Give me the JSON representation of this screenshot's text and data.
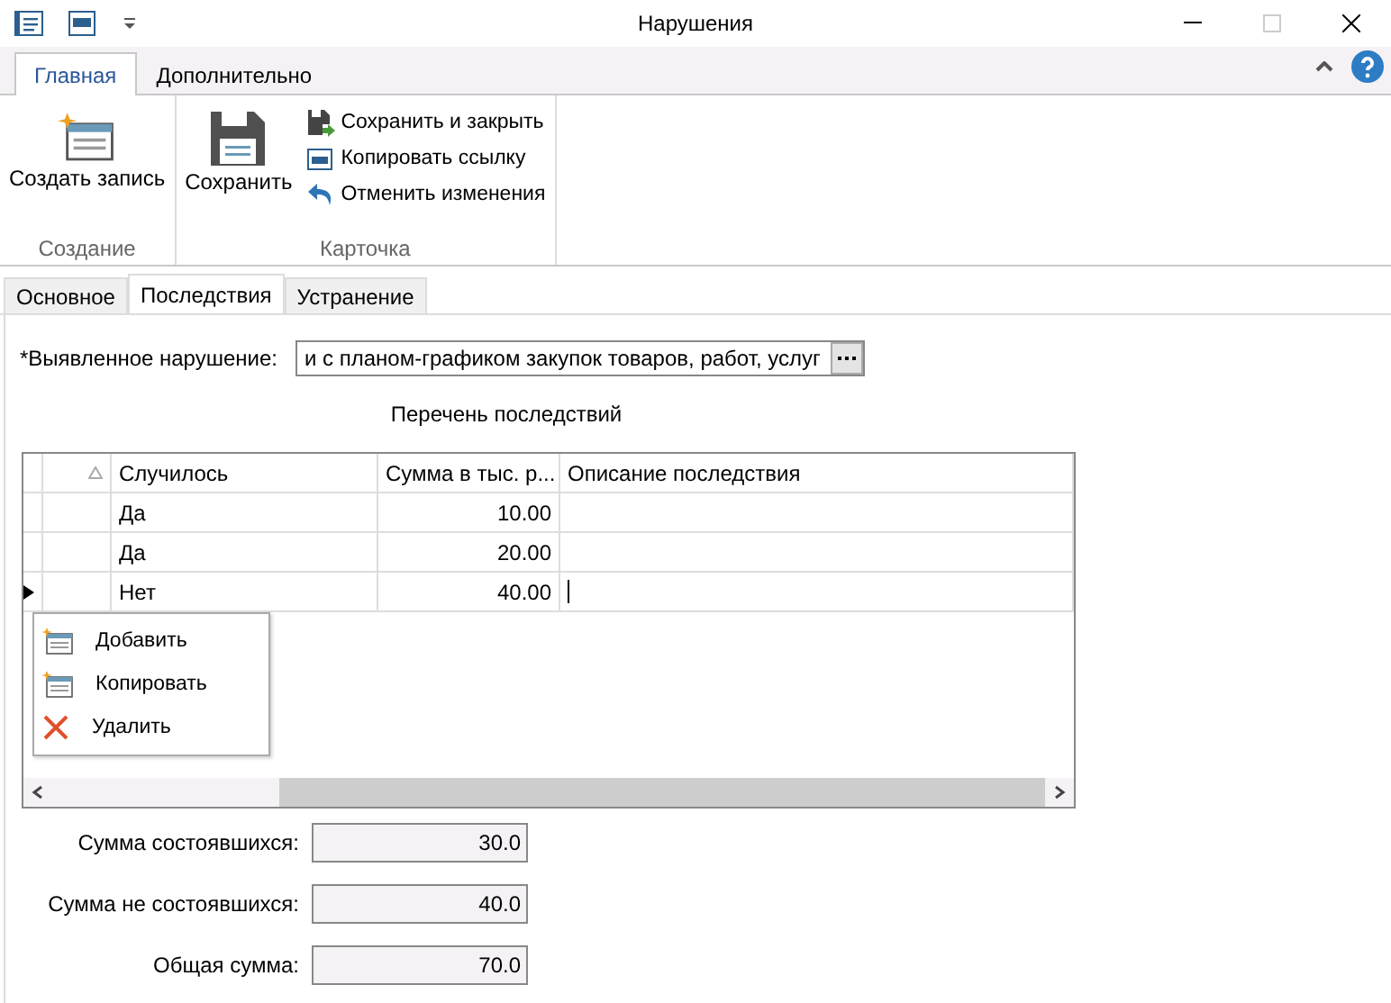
{
  "window": {
    "title": "Нарушения"
  },
  "ribbon_tabs": [
    {
      "label": "Главная",
      "selected": true
    },
    {
      "label": "Дополнительно",
      "selected": false
    }
  ],
  "ribbon_groups": [
    {
      "title": "Создание",
      "large": [
        {
          "kind": "create",
          "label": "Создать запись"
        }
      ]
    },
    {
      "title": "Карточка",
      "large": [
        {
          "kind": "save",
          "label": "Сохранить"
        }
      ],
      "small": [
        {
          "kind": "save-close",
          "label": "Сохранить и закрыть"
        },
        {
          "kind": "copy-link",
          "label": "Копировать ссылку"
        },
        {
          "kind": "undo",
          "label": "Отменить изменения"
        }
      ]
    }
  ],
  "tabs": [
    {
      "label": "Основное",
      "selected": false
    },
    {
      "label": "Последствия",
      "selected": true
    },
    {
      "label": "Устранение",
      "selected": false
    }
  ],
  "violation": {
    "label": "*Выявленное нарушение:",
    "value": "и с планом-графиком закупок товаров, работ, услуг"
  },
  "list_title": "Перечень последствий",
  "table": {
    "columns": [
      "Случилось",
      "Сумма в тыс. р...",
      "Описание последствия"
    ],
    "rows": [
      {
        "happened": "Да",
        "sum": "10.00",
        "description": "",
        "selected": false
      },
      {
        "happened": "Да",
        "sum": "20.00",
        "description": "",
        "selected": false
      },
      {
        "happened": "Нет",
        "sum": "40.00",
        "description": "",
        "selected": true
      }
    ]
  },
  "context_menu": [
    {
      "kind": "add",
      "label": "Добавить"
    },
    {
      "kind": "copy",
      "label": "Копировать"
    },
    {
      "kind": "delete",
      "label": "Удалить"
    }
  ],
  "totals": [
    {
      "label": "Сумма состоявшихся:",
      "value": "30.0"
    },
    {
      "label": "Сумма не состоявшихся:",
      "value": "40.0"
    },
    {
      "label": "Общая сумма:",
      "value": "70.0"
    }
  ]
}
